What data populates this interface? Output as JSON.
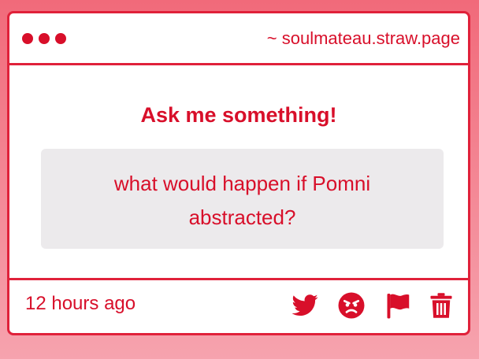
{
  "window": {
    "url": "~ soulmateau.straw.page"
  },
  "main": {
    "heading": "Ask me something!",
    "question": "what would happen if Pomni abstracted?"
  },
  "footer": {
    "timestamp": "12 hours ago",
    "actions": [
      {
        "icon": "twitter-icon"
      },
      {
        "icon": "angry-face-icon"
      },
      {
        "icon": "flag-icon"
      },
      {
        "icon": "trash-icon"
      }
    ]
  },
  "colors": {
    "accent": "#d80f2a",
    "border": "#e0213a",
    "question_bg": "#eceaec",
    "background_top": "#f16a7a",
    "background_bottom": "#f6a3ae"
  }
}
